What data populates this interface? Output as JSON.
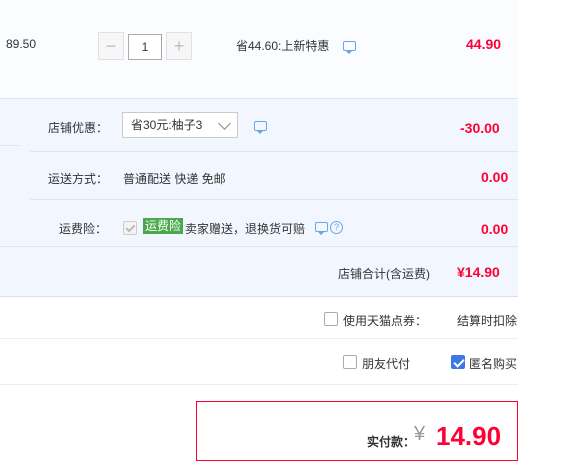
{
  "item": {
    "unit_price": "89.50",
    "quantity": "1",
    "minus": "−",
    "plus": "+",
    "promo": "省44.60:上新特惠",
    "subtotal": "44.90"
  },
  "shop": {
    "discount_label": "店铺优惠：",
    "discount_value": "省30元:柚子3",
    "discount_amount": "-30.00",
    "shipping_label": "运送方式：",
    "shipping_value": "普通配送 快递 免邮",
    "shipping_amount": "0.00",
    "insurance_label": "运费险：",
    "insurance_badge": "运费险",
    "insurance_text": "卖家赠送，退换货可赔",
    "insurance_amount": "0.00",
    "total_label": "店铺合计(含运费)",
    "total_value": "¥14.90"
  },
  "options": {
    "points_label": "使用天猫点券：",
    "points_note": "结算时扣除",
    "friend_pay_label": "朋友代付",
    "anonymous_label": "匿名购买"
  },
  "payment": {
    "label": "实付款：",
    "currency": "¥",
    "amount": "14.90"
  },
  "colors": {
    "accent_red": "#ff0036",
    "panel_bg": "#f2f7ff",
    "badge_green": "#4aa84a",
    "check_blue": "#3b7ae6"
  }
}
